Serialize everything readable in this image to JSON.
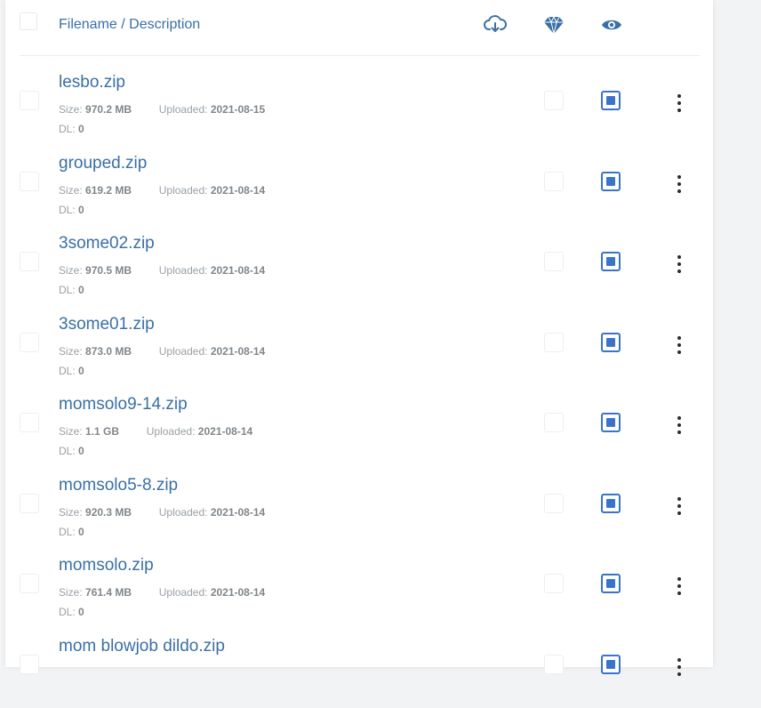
{
  "header": {
    "title": "Filename / Description",
    "icons": [
      "cloud-download-icon",
      "diamond-icon",
      "eye-icon"
    ]
  },
  "labels": {
    "size": "Size:",
    "uploaded": "Uploaded:",
    "dl": "DL:"
  },
  "colors": {
    "link": "#3a6fa6",
    "accent": "#3a74c9",
    "muted": "#9aa0a6"
  },
  "files": [
    {
      "name": "lesbo.zip",
      "size": "970.2 MB",
      "uploaded": "2021-08-15",
      "dl": "0",
      "visible": true,
      "premium": false
    },
    {
      "name": "grouped.zip",
      "size": "619.2 MB",
      "uploaded": "2021-08-14",
      "dl": "0",
      "visible": true,
      "premium": false
    },
    {
      "name": "3some02.zip",
      "size": "970.5 MB",
      "uploaded": "2021-08-14",
      "dl": "0",
      "visible": true,
      "premium": false
    },
    {
      "name": "3some01.zip",
      "size": "873.0 MB",
      "uploaded": "2021-08-14",
      "dl": "0",
      "visible": true,
      "premium": false
    },
    {
      "name": "momsolo9-14.zip",
      "size": "1.1 GB",
      "uploaded": "2021-08-14",
      "dl": "0",
      "visible": true,
      "premium": false
    },
    {
      "name": "momsolo5-8.zip",
      "size": "920.3 MB",
      "uploaded": "2021-08-14",
      "dl": "0",
      "visible": true,
      "premium": false
    },
    {
      "name": "momsolo.zip",
      "size": "761.4 MB",
      "uploaded": "2021-08-14",
      "dl": "0",
      "visible": true,
      "premium": false
    },
    {
      "name": "mom blowjob dildo.zip",
      "size": "",
      "uploaded": "",
      "dl": "",
      "visible": true,
      "premium": false
    }
  ]
}
